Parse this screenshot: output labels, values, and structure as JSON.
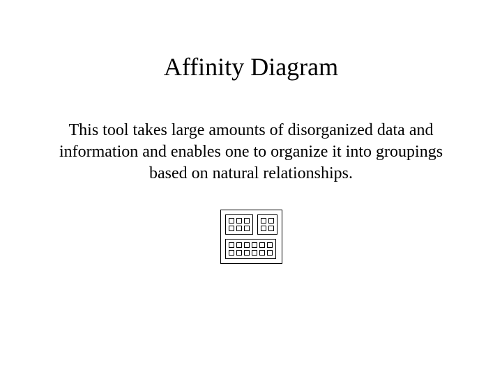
{
  "title": "Affinity Diagram",
  "description": "This tool takes large amounts of disorganized data and information and enables one to organize it into groupings based on natural relationships."
}
